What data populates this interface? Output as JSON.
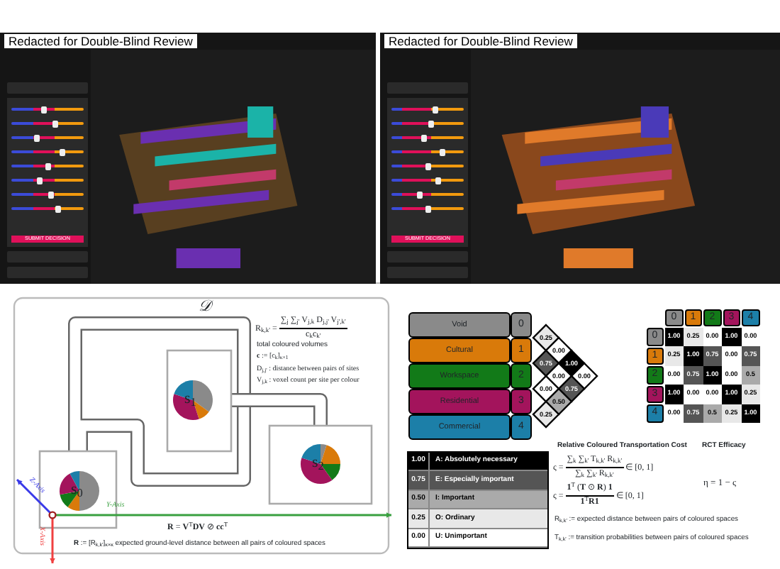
{
  "screens": [
    {
      "caption": "Redacted for Double-Blind Review",
      "kind": "allocated",
      "button": "SUBMIT DECISION",
      "sliders": [
        {
          "level": 0.45
        },
        {
          "level": 0.6
        },
        {
          "level": 0.35
        },
        {
          "level": 0.7
        },
        {
          "level": 0.5
        },
        {
          "level": 0.4
        },
        {
          "level": 0.55
        },
        {
          "level": 0.65
        }
      ]
    },
    {
      "caption": "Redacted for Double-Blind Review",
      "kind": "massing",
      "button": "SUBMIT DECISION",
      "sliders": [
        {
          "level": 0.6
        },
        {
          "level": 0.55
        },
        {
          "level": 0.45
        },
        {
          "level": 0.7
        },
        {
          "level": 0.5
        },
        {
          "level": 0.65
        },
        {
          "level": 0.4
        },
        {
          "level": 0.5
        }
      ]
    }
  ],
  "diagram": {
    "domain_label": "𝒟",
    "formula": {
      "lhs": "R$_{k,k'}$ =",
      "numerator": "∑$_{j}$ ∑$_{j'}$ V$_{j,k}$ D$_{j,j'}$ V$_{j',k'}$",
      "denominator": "c$_{k}$c$_{k'}$"
    },
    "notes": [
      "total coloured volumes",
      "**c** := [c$_{k}$]$_{κ×1}$",
      "D$_{j,j'}$ : distance between pairs of sites",
      "V$_{j,k}$ : voxel count per site per colour"
    ],
    "sites": [
      {
        "label": "s$_{0}$"
      },
      {
        "label": "s$_{1}$"
      },
      {
        "label": "s$_{2}$"
      }
    ],
    "axes": [
      {
        "kind": "z",
        "label": "Z-Axis"
      },
      {
        "kind": "y",
        "label": "Y-Axis"
      },
      {
        "kind": "x",
        "label": "X-Axis"
      }
    ],
    "equation": "**R** = **V**$^{T}$**DV** ⊘ **cc**$^{T}$",
    "definition": "**R** := [R$_{k,k'}$]$_{κ×κ}$ expected ground-level distance between all pairs of coloured spaces"
  },
  "categories": [
    {
      "name": "Void",
      "index": "0",
      "color": "#8a8a8a"
    },
    {
      "name": "Cultural",
      "index": "1",
      "color": "#d97a0a"
    },
    {
      "name": "Workspace",
      "index": "2",
      "color": "#127a18"
    },
    {
      "name": "Residential",
      "index": "3",
      "color": "#a3145c"
    },
    {
      "name": "Commercial",
      "index": "4",
      "color": "#1c7fa8"
    }
  ],
  "pairs": [
    [
      {
        "v": "0.25",
        "color": "#e8e8e8"
      },
      {
        "v": "0.00",
        "color": "#ffffff"
      },
      {
        "v": "1.00",
        "color": "#000000"
      },
      {
        "v": "0.00",
        "color": "#ffffff"
      }
    ],
    [
      {
        "v": "0.75",
        "color": "#555555"
      },
      {
        "v": "0.00",
        "color": "#ffffff"
      },
      {
        "v": "0.75",
        "color": "#555555"
      }
    ],
    [
      {
        "v": "0.00",
        "color": "#ffffff"
      },
      {
        "v": "0.50",
        "color": "#aaaaaa"
      }
    ],
    [
      {
        "v": "0.25",
        "color": "#e8e8e8"
      }
    ]
  ],
  "matrix": {
    "columns": [
      {
        "label": "0",
        "color": "#8a8a8a"
      },
      {
        "label": "1",
        "color": "#d97a0a"
      },
      {
        "label": "2",
        "color": "#127a18"
      },
      {
        "label": "3",
        "color": "#a3145c"
      },
      {
        "label": "4",
        "color": "#1c7fa8"
      }
    ],
    "rows": [
      {
        "label": "0",
        "color": "#8a8a8a",
        "cells": [
          {
            "v": "1.00",
            "color": "#000000"
          },
          {
            "v": "0.25",
            "color": "#e8e8e8"
          },
          {
            "v": "0.00",
            "color": "#ffffff"
          },
          {
            "v": "1.00",
            "color": "#000000"
          },
          {
            "v": "0.00",
            "color": "#ffffff"
          }
        ]
      },
      {
        "label": "1",
        "color": "#d97a0a",
        "cells": [
          {
            "v": "0.25",
            "color": "#e8e8e8"
          },
          {
            "v": "1.00",
            "color": "#000000"
          },
          {
            "v": "0.75",
            "color": "#555555"
          },
          {
            "v": "0.00",
            "color": "#ffffff"
          },
          {
            "v": "0.75",
            "color": "#555555"
          }
        ]
      },
      {
        "label": "2",
        "color": "#127a18",
        "cells": [
          {
            "v": "0.00",
            "color": "#ffffff"
          },
          {
            "v": "0.75",
            "color": "#555555"
          },
          {
            "v": "1.00",
            "color": "#000000"
          },
          {
            "v": "0.00",
            "color": "#ffffff"
          },
          {
            "v": "0.5",
            "color": "#aaaaaa"
          }
        ]
      },
      {
        "label": "3",
        "color": "#a3145c",
        "cells": [
          {
            "v": "1.00",
            "color": "#000000"
          },
          {
            "v": "0.00",
            "color": "#ffffff"
          },
          {
            "v": "0.00",
            "color": "#ffffff"
          },
          {
            "v": "1.00",
            "color": "#000000"
          },
          {
            "v": "0.25",
            "color": "#e8e8e8"
          }
        ]
      },
      {
        "label": "4",
        "color": "#1c7fa8",
        "cells": [
          {
            "v": "0.00",
            "color": "#ffffff"
          },
          {
            "v": "0.75",
            "color": "#555555"
          },
          {
            "v": "0.5",
            "color": "#aaaaaa"
          },
          {
            "v": "0.25",
            "color": "#e8e8e8"
          },
          {
            "v": "1.00",
            "color": "#000000"
          }
        ]
      }
    ]
  },
  "legend": [
    {
      "value": "1.00",
      "label": "A: Absolutely necessary",
      "color": "#000000"
    },
    {
      "value": "0.75",
      "label": "E: Especially important",
      "color": "#555555"
    },
    {
      "value": "0.50",
      "label": "I: Important",
      "color": "#aaaaaa"
    },
    {
      "value": "0.25",
      "label": "O: Ordinary",
      "color": "#e8e8e8"
    },
    {
      "value": "0.00",
      "label": "U: Unimportant",
      "color": "#ffffff"
    }
  ],
  "cost": {
    "title": "Relative Coloured Transportation Cost",
    "formulas": [
      {
        "lhs": "ς =",
        "numerator": "∑$_{k}$ ∑$_{k'}$ T$_{k,k'}$ R$_{k,k'}$",
        "denominator": "∑$_{k}$ ∑$_{k'}$ R$_{k,k'}$",
        "rhs": "∈ [0, 1]"
      },
      {
        "lhs": "ς =",
        "numerator": "**1**$^{T}$ (**T** ⊙ **R**) **1**",
        "denominator": "**1**$^{T}$**R1**",
        "rhs": "∈ [0, 1]"
      }
    ],
    "definitions": [
      "R$_{k,k'}$ := expected distance between pairs of coloured spaces",
      "T$_{k,k'}$ := transition probabilities between pairs of coloured spaces"
    ]
  },
  "efficacy": {
    "title": "RCT Efficacy",
    "formula": "η = 1 − ς"
  }
}
